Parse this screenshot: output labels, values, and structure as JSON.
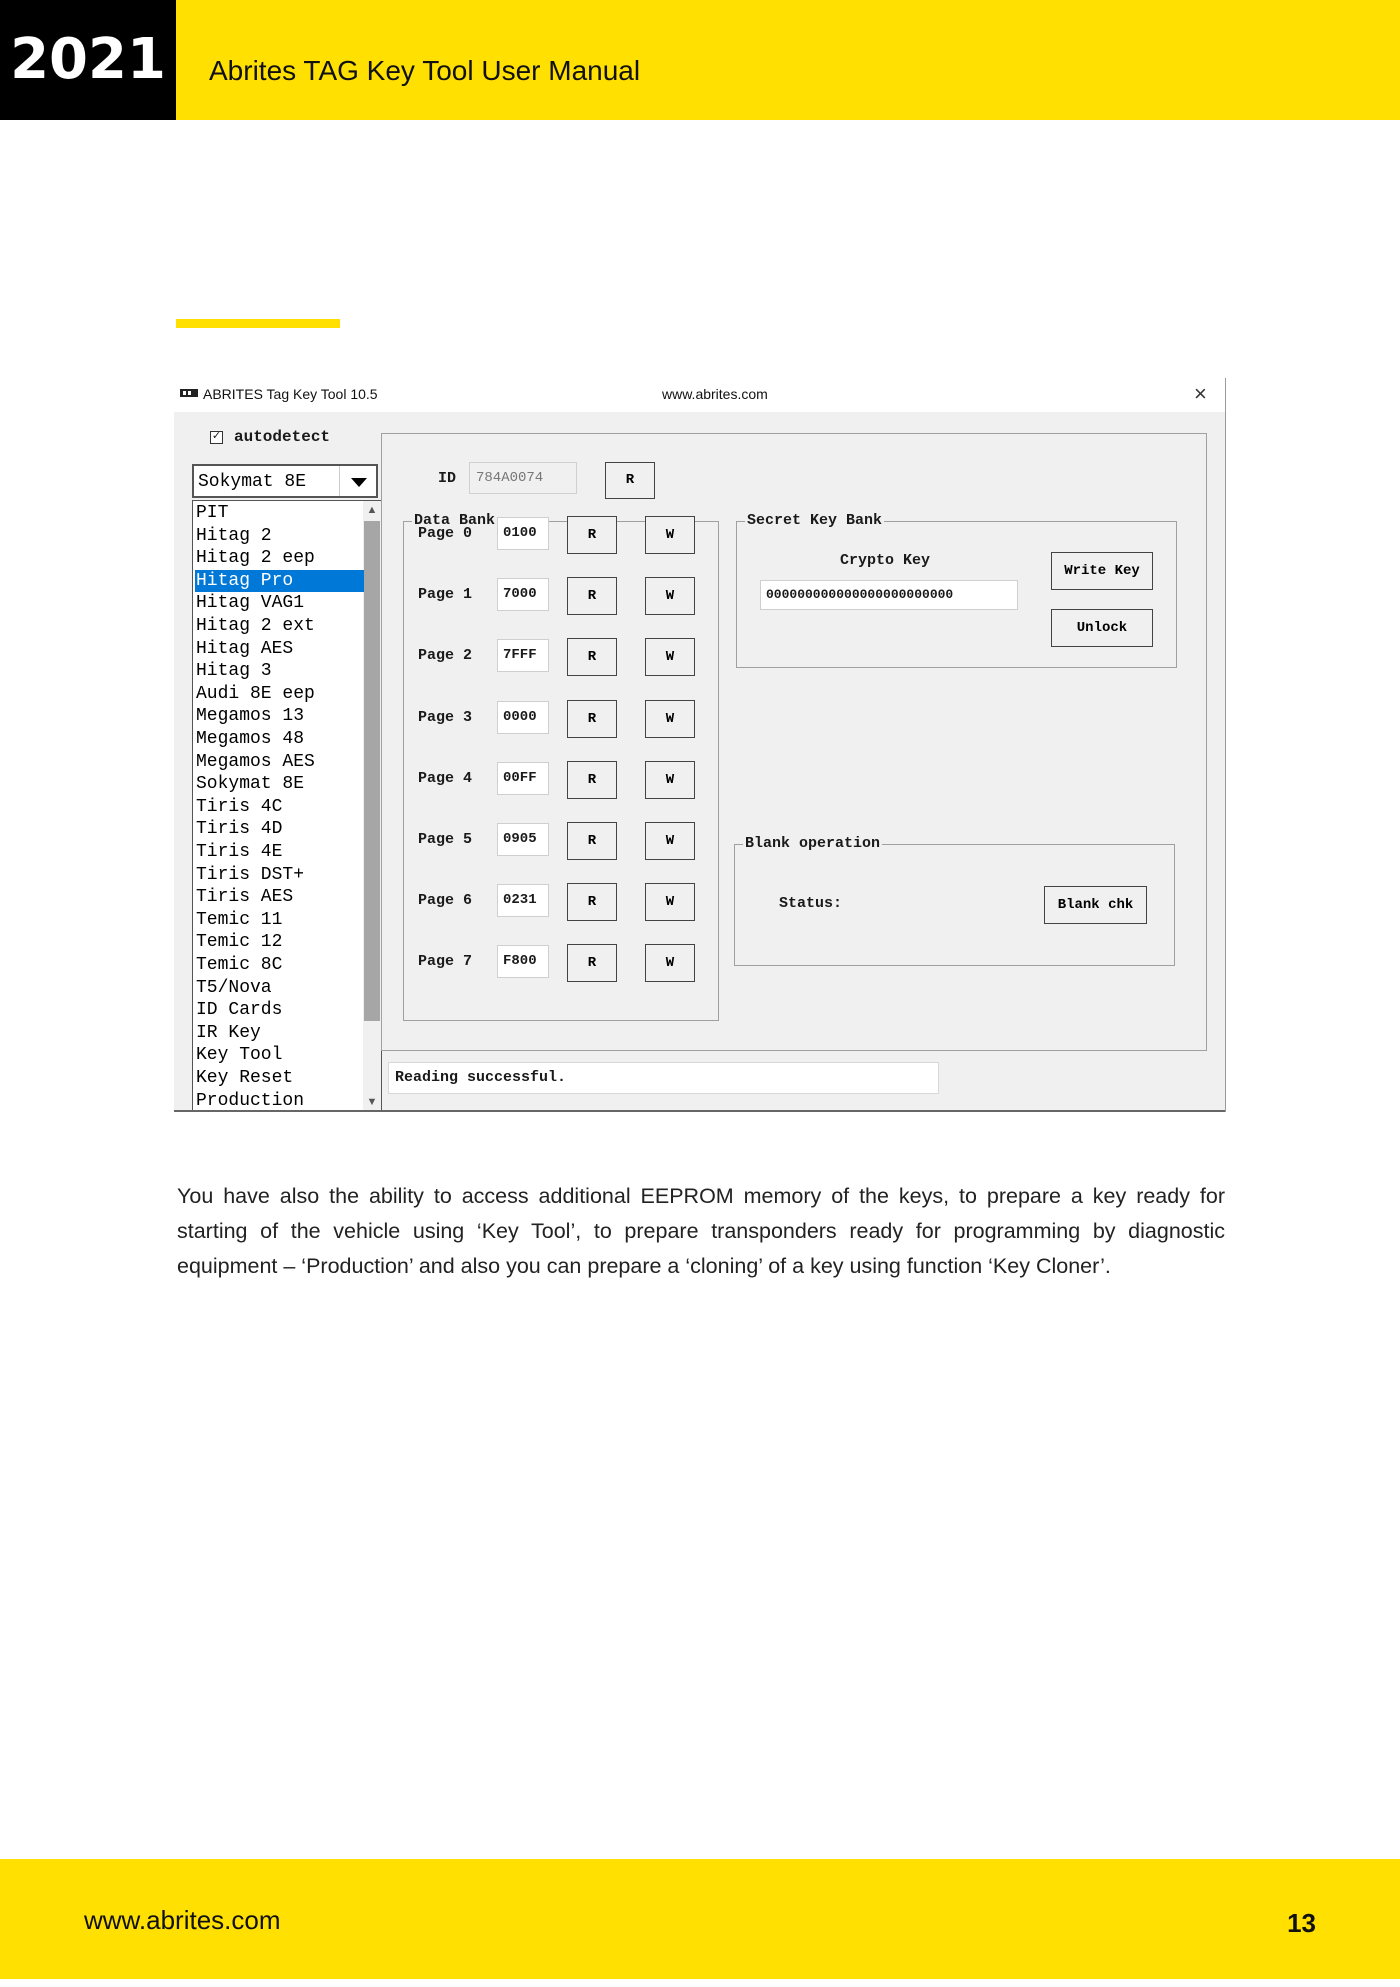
{
  "header": {
    "year": "2021",
    "title": "Abrites TAG Key Tool User Manual"
  },
  "window": {
    "title": "ABRITES Tag Key Tool 10.5",
    "url": "www.abrites.com",
    "close_label": "×"
  },
  "left_panel": {
    "autodetect_check": "☑",
    "autodetect_label": "autodetect",
    "selected_type": "Sokymat 8E",
    "list_items": [
      "PIT",
      "Hitag 2",
      "Hitag 2 eep",
      "Hitag Pro",
      "Hitag VAG1",
      "Hitag 2 ext",
      "Hitag AES",
      "Hitag 3",
      "Audi 8E eep",
      "Megamos 13",
      "Megamos 48",
      "Megamos AES",
      "Sokymat 8E",
      "Tiris 4C",
      "Tiris 4D",
      "Tiris 4E",
      "Tiris DST+",
      "Tiris AES",
      "Temic 11",
      "Temic 12",
      "Temic 8C",
      "T5/Nova",
      "ID Cards",
      "IR Key",
      "Key Tool",
      "Key Reset",
      "Production"
    ],
    "highlighted_index": 3
  },
  "id_row": {
    "label": "ID",
    "value": "784A0074",
    "read_button": "R"
  },
  "data_bank": {
    "title": "Data Bank",
    "pages": [
      {
        "label": "Page 0",
        "value": "0100",
        "read": "R",
        "write": "W"
      },
      {
        "label": "Page 1",
        "value": "7000",
        "read": "R",
        "write": "W"
      },
      {
        "label": "Page 2",
        "value": "7FFF",
        "read": "R",
        "write": "W"
      },
      {
        "label": "Page 3",
        "value": "0000",
        "read": "R",
        "write": "W"
      },
      {
        "label": "Page 4",
        "value": "00FF",
        "read": "R",
        "write": "W"
      },
      {
        "label": "Page 5",
        "value": "0905",
        "read": "R",
        "write": "W"
      },
      {
        "label": "Page 6",
        "value": "0231",
        "read": "R",
        "write": "W"
      },
      {
        "label": "Page 7",
        "value": "F800",
        "read": "R",
        "write": "W"
      }
    ]
  },
  "secret_key_bank": {
    "title": "Secret Key Bank",
    "crypto_label": "Crypto Key",
    "crypto_value": "000000000000000000000000",
    "write_key_button": "Write Key",
    "unlock_button": "Unlock"
  },
  "blank_operation": {
    "title": "Blank operation",
    "status_label": "Status:",
    "blank_check_button": "Blank chk"
  },
  "status_bar": "Reading successful.",
  "paragraph": "You have also the ability to access additional EEPROM memory of the keys, to prepare a key ready for starting of the vehicle using ‘Key Tool’, to prepare transponders ready for programming by diagnostic equipment – ‘Production’ and also you can prepare a ‘cloning’ of a key using function ‘Key Cloner’.",
  "footer": {
    "url": "www.abrites.com",
    "page_number": "13"
  },
  "colors": {
    "brand_yellow": "#FFE000",
    "selection_blue": "#0078d7"
  }
}
